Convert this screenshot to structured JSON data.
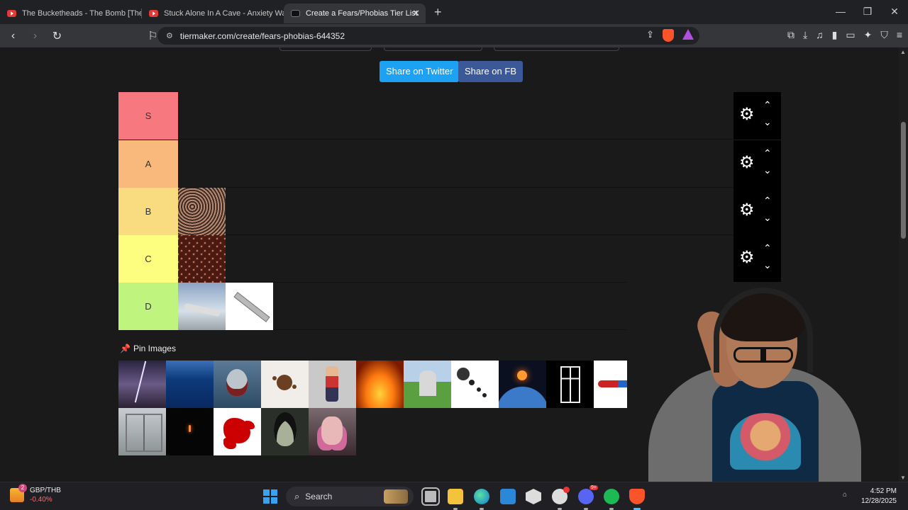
{
  "tabs": [
    {
      "title": "The Bucketheads - The Bomb [These",
      "active": false
    },
    {
      "title": "Stuck Alone In A Cave - Anxiety Warn",
      "active": false
    },
    {
      "title": "Create a Fears/Phobias Tier List",
      "active": true
    }
  ],
  "window_controls": {
    "minimize": "—",
    "restore": "❐",
    "close": "✕"
  },
  "toolbar": {
    "url": "tiermaker.com/create/fears-phobias-644352",
    "brave_badge": "5",
    "rewards_badge": "1"
  },
  "share": {
    "twitter": "Share on Twitter",
    "facebook": "Share on FB"
  },
  "tiers": [
    {
      "label": "S",
      "color": "#f7787e",
      "items": []
    },
    {
      "label": "A",
      "color": "#f9b97d",
      "items": []
    },
    {
      "label": "B",
      "color": "#f9dc7f",
      "items": [
        "crowd"
      ]
    },
    {
      "label": "C",
      "color": "#fdfe7f",
      "items": [
        "trypophobia-holes"
      ]
    },
    {
      "label": "D",
      "color": "#bff47f",
      "items": [
        "airplane",
        "syringe"
      ]
    }
  ],
  "tier_controls": {
    "gear": "⚙",
    "up": "⌃",
    "down": "⌄"
  },
  "pin_images": {
    "heading": "Pin Images",
    "items": [
      "lightning-storm",
      "deep-ocean",
      "shark",
      "spider",
      "puppet",
      "fire",
      "gravestone",
      "microphone",
      "earth-apocalypse",
      "dark-window",
      "knotted-rope",
      "clown",
      "heights",
      "darkness-candle",
      "blood",
      "alien",
      "scared-doll"
    ]
  },
  "taskbar": {
    "weather_badge": "2",
    "ticker": "GBP/THB",
    "ticker_change": "-0.40%",
    "search_label": "Search",
    "discord_badge": "9+",
    "time": "4:52 PM",
    "date": "12/28/2025"
  }
}
